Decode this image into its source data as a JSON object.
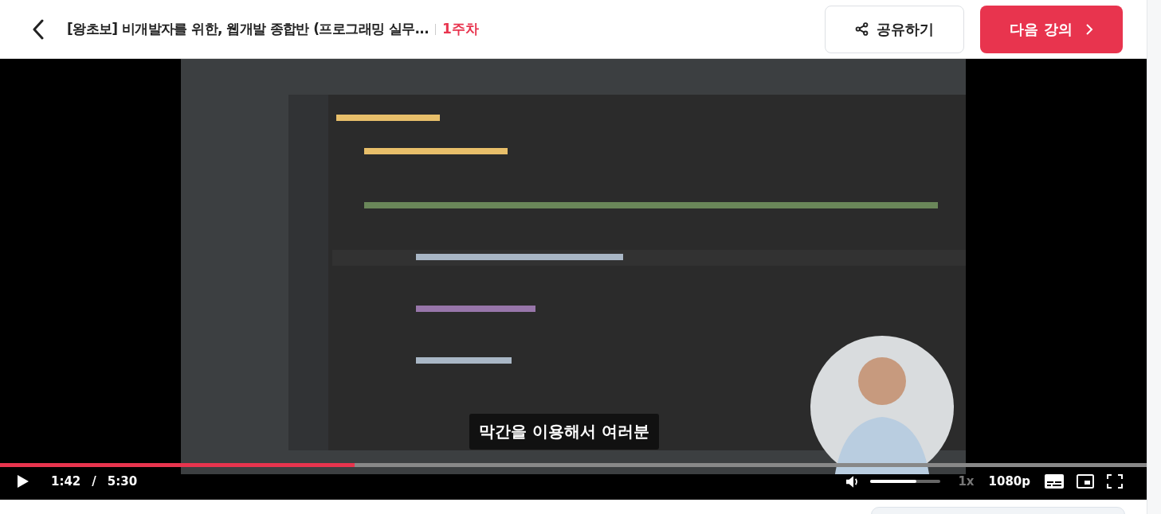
{
  "header": {
    "title": "[왕초보] 비개발자를 위한, 웹개발 종합반 (프로그래밍 실무...",
    "week": "1주차",
    "share_button": "공유하기",
    "next_button": "다음 강의"
  },
  "video": {
    "kind": "picture",
    "subtitle": "막간을 이용해서 여러분",
    "progress": {
      "level": 0.309
    },
    "playing": false,
    "current_time": "1:42",
    "time_separator": "/",
    "duration": "5:30",
    "volume": {
      "level": 0.65
    },
    "speed": "1x",
    "quality": "1080p"
  }
}
